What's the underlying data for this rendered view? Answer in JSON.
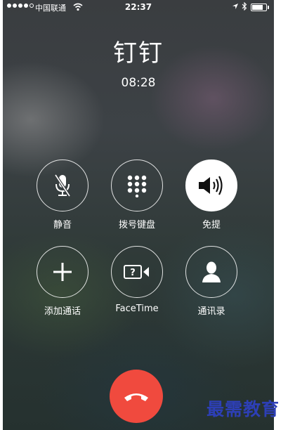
{
  "status_bar": {
    "carrier": "中国联通",
    "time": "22:37"
  },
  "call": {
    "caller_name": "钉钉",
    "duration": "08:28"
  },
  "controls": [
    {
      "label": "静音",
      "icon": "mic-muted-icon",
      "active": false
    },
    {
      "label": "拨号键盘",
      "icon": "keypad-icon",
      "active": false
    },
    {
      "label": "免提",
      "icon": "speaker-icon",
      "active": true
    },
    {
      "label": "添加通话",
      "icon": "plus-icon",
      "active": false
    },
    {
      "label": "FaceTime",
      "icon": "facetime-icon",
      "active": false
    },
    {
      "label": "通讯录",
      "icon": "contacts-icon",
      "active": false
    }
  ],
  "end_call": {
    "icon": "end-call-icon",
    "color": "#f04a3e"
  },
  "watermark": "最需教育"
}
